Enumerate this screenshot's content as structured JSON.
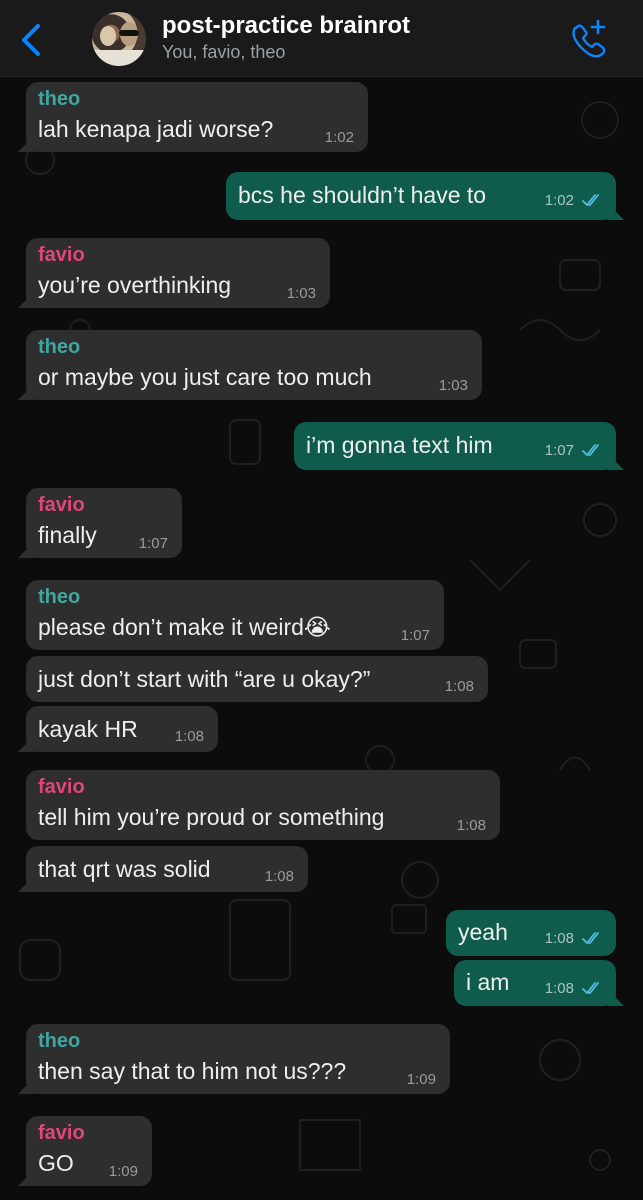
{
  "header": {
    "back_icon": "chevron-left-icon",
    "title": "post-practice brainrot",
    "members": "You, favio, theo",
    "call_icon": "phone-plus-icon",
    "accent_color": "#0a84ff"
  },
  "colors": {
    "incoming_bubble": "#2e2e2e",
    "outgoing_bubble": "#105c4c",
    "theo_name": "#3fa6a0",
    "favio_name": "#e0457b",
    "read_ticks": "#53bdeb"
  },
  "messages": [
    {
      "sender": "theo",
      "text": "lah kenapa jadi worse?",
      "time": "1:02"
    },
    {
      "sender": "",
      "text": "bcs he shouldn’t have to",
      "time": "1:02",
      "status": "read"
    },
    {
      "sender": "favio",
      "text": "you’re overthinking",
      "time": "1:03"
    },
    {
      "sender": "theo",
      "text": "or maybe you just care too much",
      "time": "1:03"
    },
    {
      "sender": "",
      "text": "i’m gonna text him",
      "time": "1:07",
      "status": "read"
    },
    {
      "sender": "favio",
      "text": "finally",
      "time": "1:07"
    },
    {
      "sender": "theo",
      "text": "please don’t make it weird😭",
      "time": "1:07"
    },
    {
      "sender": "",
      "text": "just don’t start with “are u okay?”",
      "time": "1:08"
    },
    {
      "sender": "",
      "text": "kayak HR",
      "time": "1:08"
    },
    {
      "sender": "favio",
      "text": "tell him you’re proud or something",
      "time": "1:08"
    },
    {
      "sender": "",
      "text": "that qrt was solid",
      "time": "1:08"
    },
    {
      "sender": "",
      "text": "yeah",
      "time": "1:08",
      "status": "read"
    },
    {
      "sender": "",
      "text": "i am",
      "time": "1:08",
      "status": "read"
    },
    {
      "sender": "theo",
      "text": "then say that to him not us???",
      "time": "1:09"
    },
    {
      "sender": "favio",
      "text": "GO",
      "time": "1:09"
    }
  ]
}
